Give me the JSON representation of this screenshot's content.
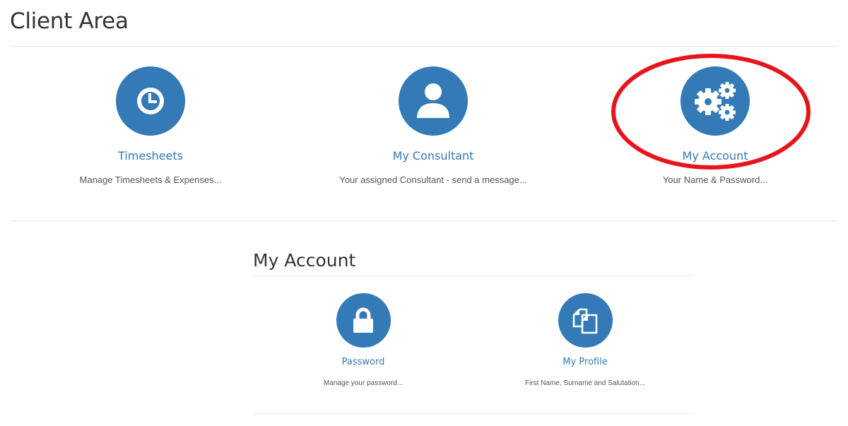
{
  "colors": {
    "brand": "#337ab7",
    "highlight": "#e8141b"
  },
  "page": {
    "title": "Client Area"
  },
  "client_tiles": [
    {
      "icon": "clock-icon",
      "label": "Timesheets",
      "description": "Manage Timesheets & Expenses..."
    },
    {
      "icon": "user-icon",
      "label": "My Consultant",
      "description": "Your assigned Consultant - send a message..."
    },
    {
      "icon": "gears-icon",
      "label": "My Account",
      "description": "Your Name & Password...",
      "highlighted": true
    }
  ],
  "my_account": {
    "title": "My Account",
    "tiles": [
      {
        "icon": "lock-icon",
        "label": "Password",
        "description": "Manage your password..."
      },
      {
        "icon": "copy-icon",
        "label": "My Profile",
        "description": "First Name, Surname and Salutation..."
      }
    ]
  }
}
